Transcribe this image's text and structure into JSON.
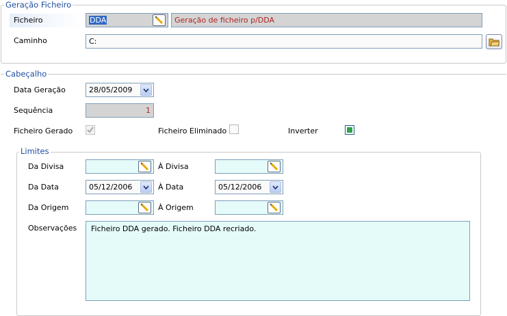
{
  "geracao": {
    "title": "Geração Ficheiro",
    "ficheiro_label": "Ficheiro",
    "ficheiro_value": "DDA",
    "ficheiro_desc": "Geração de ficheiro p/DDA",
    "caminho_label": "Caminho",
    "caminho_value": "C:"
  },
  "cabecalho": {
    "title": "Cabeçalho",
    "data_geracao_label": "Data Geração",
    "data_geracao_value": "28/05/2009",
    "sequencia_label": "Sequência",
    "sequencia_value": "1",
    "ficheiro_gerado_label": "Ficheiro Gerado",
    "ficheiro_gerado_checked": true,
    "ficheiro_eliminado_label": "Ficheiro Eliminado",
    "ficheiro_eliminado_checked": false,
    "inverter_label": "Inverter",
    "inverter_checked": true
  },
  "limites": {
    "title": "Limites",
    "da_divisa_label": "Da Divisa",
    "da_divisa_value": "",
    "a_divisa_label": "À Divisa",
    "a_divisa_value": "",
    "da_data_label": "Da Data",
    "da_data_value": "05/12/2006",
    "a_data_label": "À Data",
    "a_data_value": "05/12/2006",
    "da_origem_label": "Da Origem",
    "da_origem_value": "",
    "a_origem_label": "À Origem",
    "a_origem_value": "",
    "observacoes_label": "Observações",
    "observacoes_value": "Ficheiro DDA gerado. Ficheiro DDA recriado."
  },
  "colors": {
    "group_title": "#1f4d9e",
    "sequence_value": "#b22222",
    "description_text": "#b22222",
    "field_mint": "#e4fbf9",
    "field_gray": "#d4d4d4",
    "selected_label_bg": "#e6eefb"
  }
}
